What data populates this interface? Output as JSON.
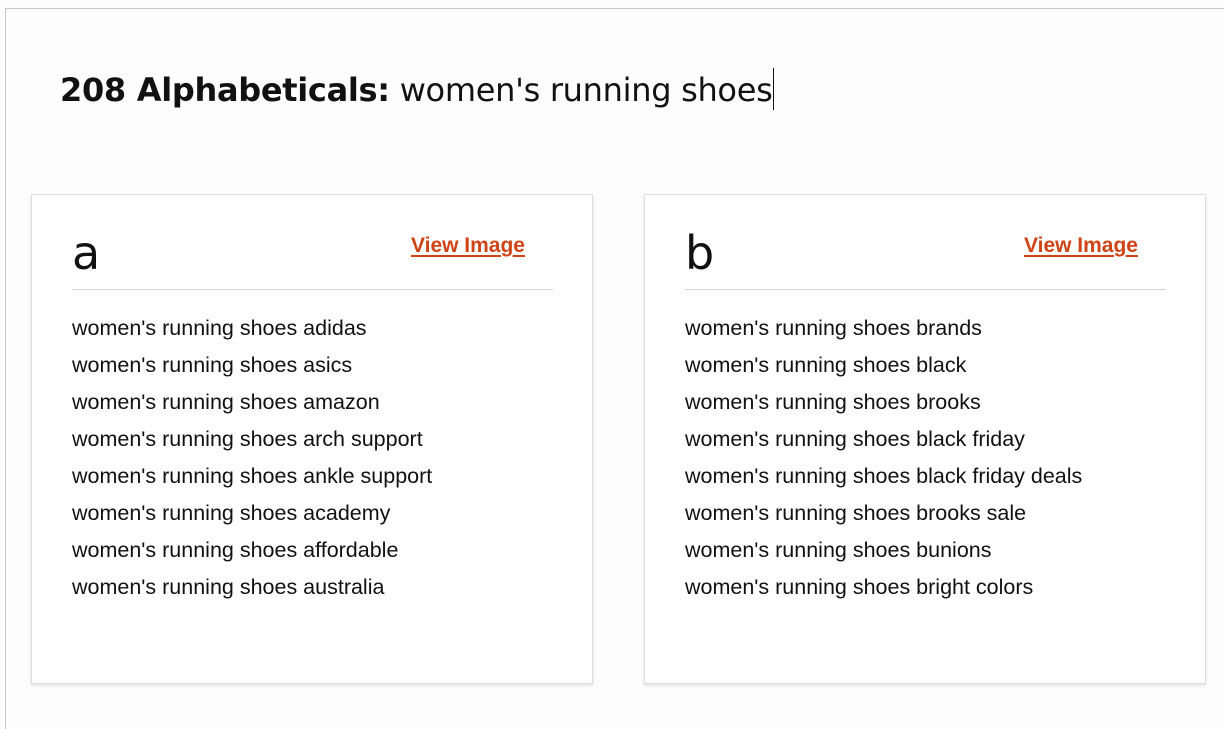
{
  "header": {
    "count_label": "208 Alphabeticals:",
    "query": "women's running shoes"
  },
  "colors": {
    "link": "#cf4416",
    "text": "#111111",
    "border": "#dcdcdc"
  },
  "groups": [
    {
      "letter": "a",
      "view_image_label": "View Image",
      "items": [
        "women's running shoes adidas",
        "women's running shoes asics",
        "women's running shoes amazon",
        "women's running shoes arch support",
        "women's running shoes ankle support",
        "women's running shoes academy",
        "women's running shoes affordable",
        "women's running shoes australia"
      ]
    },
    {
      "letter": "b",
      "view_image_label": "View Image",
      "items": [
        "women's running shoes brands",
        "women's running shoes black",
        "women's running shoes brooks",
        "women's running shoes black friday",
        "women's running shoes black friday deals",
        "women's running shoes brooks sale",
        "women's running shoes bunions",
        "women's running shoes bright colors"
      ]
    }
  ]
}
